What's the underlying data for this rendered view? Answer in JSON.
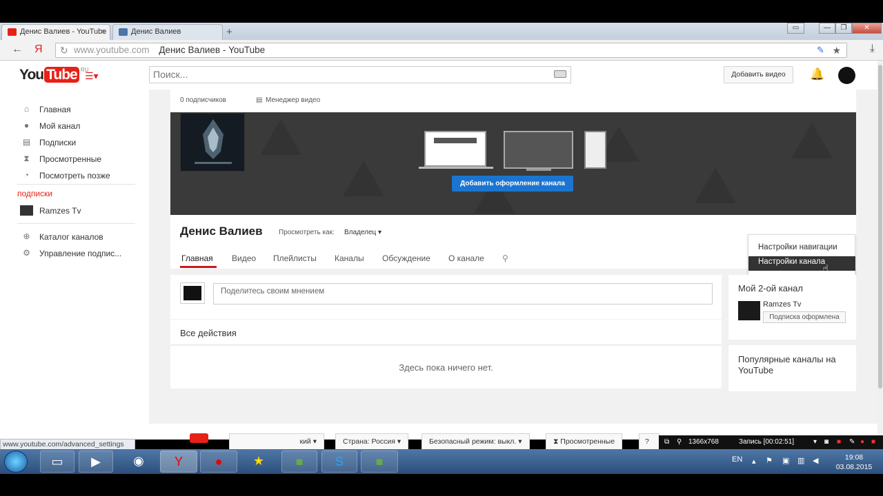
{
  "browser": {
    "tabs": [
      {
        "label": "Денис Валиев - YouTube",
        "close": "×"
      },
      {
        "label": "Денис Валиев"
      }
    ],
    "new_tab": "+",
    "back": "←",
    "yandex": "Я",
    "url_domain": "www.youtube.com",
    "url_title": "Денис Валиев - YouTube",
    "window_controls": [
      "▭",
      "—",
      "❐",
      "✕"
    ]
  },
  "masthead": {
    "logo_you": "You",
    "logo_tube": "Tube",
    "logo_region": "RU",
    "search_placeholder": "Поиск...",
    "upload_label": "Добавить видео"
  },
  "guide": {
    "items": [
      {
        "label": "Главная",
        "icon": "home-icon"
      },
      {
        "label": "Мой канал",
        "icon": "user-icon"
      },
      {
        "label": "Подписки",
        "icon": "subscriptions-icon"
      },
      {
        "label": "Просмотренные",
        "icon": "hourglass-icon"
      },
      {
        "label": "Посмотреть позже",
        "icon": "clock-icon"
      }
    ],
    "section_title": "подписки",
    "subscriptions": [
      {
        "label": "Ramzes Tv"
      }
    ],
    "bottom_items": [
      {
        "label": "Каталог каналов",
        "icon": "plus-circle-icon"
      },
      {
        "label": "Управление подпис...",
        "icon": "gear-icon"
      }
    ]
  },
  "channel": {
    "subscribers": "0 подписчиков",
    "video_manager": "Менеджер видео",
    "add_art_button": "Добавить оформление канала",
    "name": "Денис Валиев",
    "view_as_label": "Просмотреть как:",
    "view_as_value": "Владелец",
    "tabs": [
      "Главная",
      "Видео",
      "Плейлисты",
      "Каналы",
      "Обсуждение",
      "О канале"
    ],
    "active_tab": "Главная"
  },
  "settings_menu": {
    "items": [
      "Настройки навигации",
      "Настройки канала"
    ],
    "selected": "Настройки канала"
  },
  "feed": {
    "share_placeholder": "Поделитесь своим мнением",
    "all_activity_title": "Все действия",
    "empty_message": "Здесь пока ничего нет."
  },
  "sidebar": {
    "second_channel_title": "Мой 2-ой канал",
    "second_channel_name": "Ramzes Tv",
    "subscribed_label": "Подписка оформлена",
    "popular_title": "Популярные каналы на YouTube"
  },
  "footer": {
    "language_label": "кий",
    "country_label": "Страна: Россия",
    "safe_mode_label": "Безопасный режим: выкл.",
    "history_label": "Просмотренные"
  },
  "status_url": "www.youtube.com/advanced_settings",
  "recorder": {
    "resolution": "1366x768",
    "record_label": "Запись [00:02:51]"
  },
  "taskbar": {
    "language": "EN",
    "time": "19:08",
    "date": "03.08.2015"
  },
  "colors": {
    "youtube_red": "#e62117",
    "accent_blue": "#1b75d0",
    "taskbar": "#2c4f7c"
  }
}
